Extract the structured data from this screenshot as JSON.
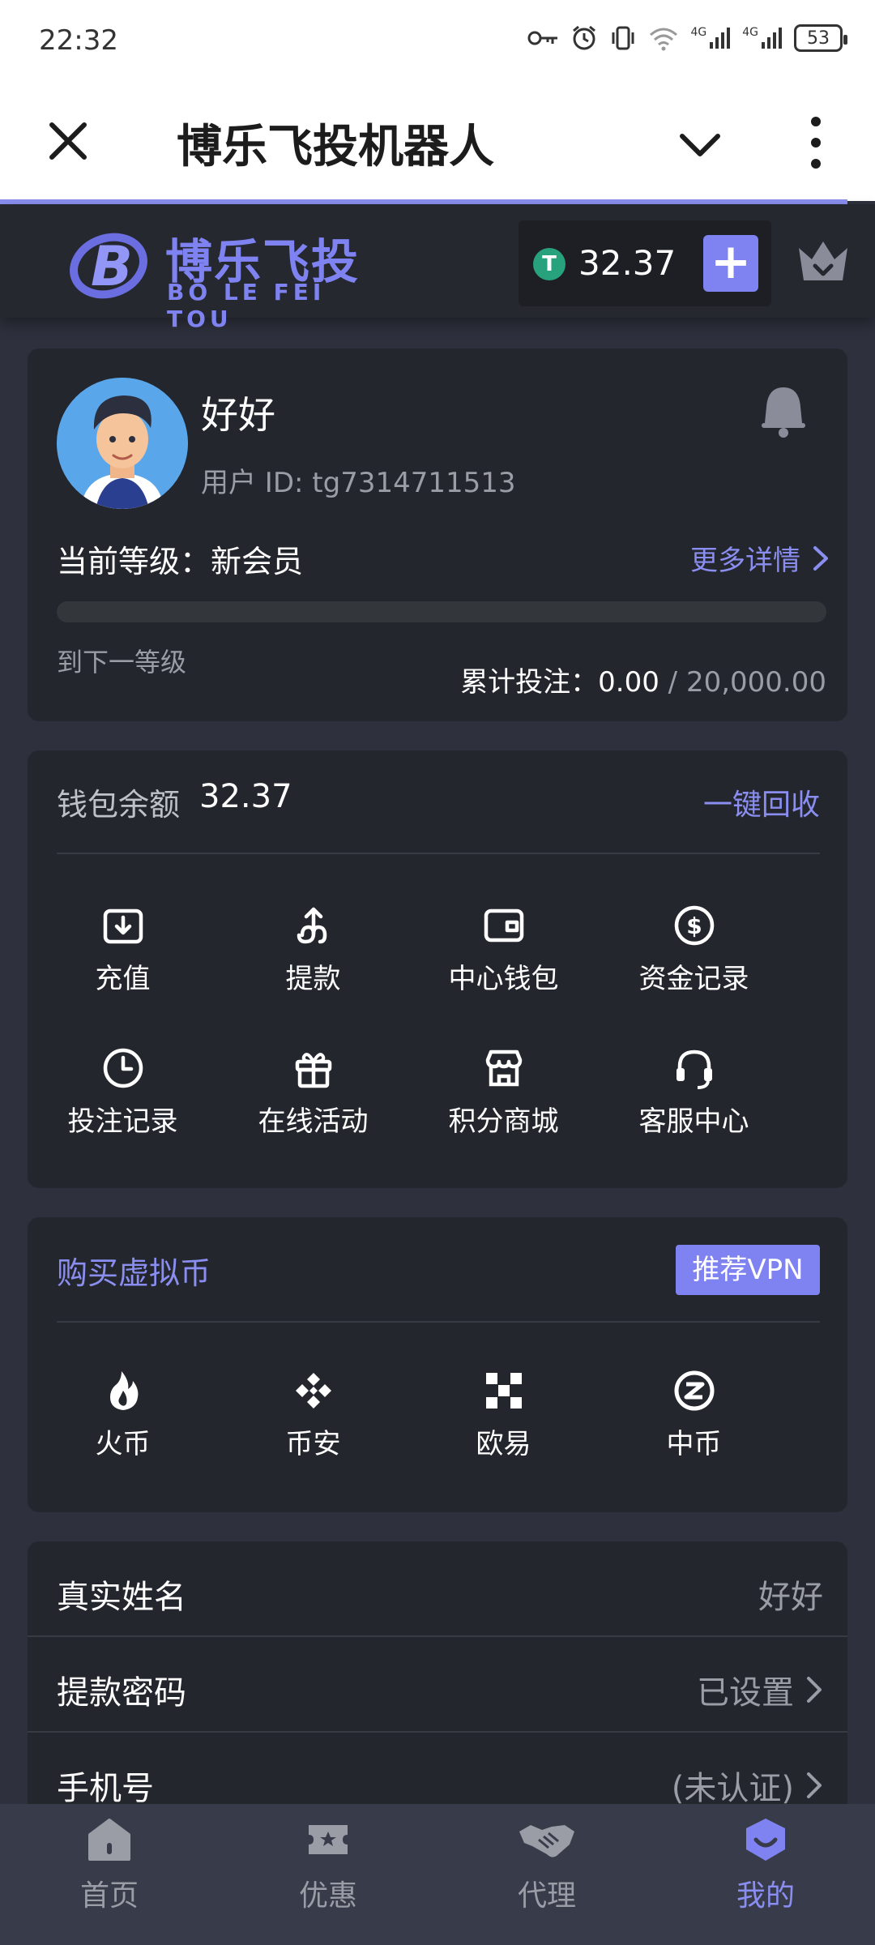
{
  "status_bar": {
    "time": "22:32",
    "network_1": "4G",
    "network_2": "4G",
    "battery": "53"
  },
  "title_bar": {
    "title": "博乐飞投机器人"
  },
  "header": {
    "logo_cn": "博乐飞投",
    "logo_en": "BO LE FEI TOU",
    "currency_symbol": "T",
    "balance": "32.37",
    "plus_label": "+"
  },
  "profile": {
    "username": "好好",
    "user_id": "用户 ID: tg7314711513",
    "level_label": "当前等级：新会员",
    "more_details": "更多详情",
    "level_progress_percent": 0,
    "next_level": "到下一等级",
    "bet_total_label": "累计投注：",
    "bet_total_value": "0.00",
    "bet_total_separator": " / ",
    "bet_total_target": "20,000.00"
  },
  "wallet": {
    "label": "钱包余额",
    "amount": "32.37",
    "recycle": "一键回收",
    "items": [
      {
        "label": "充值",
        "icon": "deposit-icon"
      },
      {
        "label": "提款",
        "icon": "withdraw-icon"
      },
      {
        "label": "中心钱包",
        "icon": "wallet-icon"
      },
      {
        "label": "资金记录",
        "icon": "dollar-icon"
      },
      {
        "label": "投注记录",
        "icon": "clock-icon"
      },
      {
        "label": "在线活动",
        "icon": "gift-icon"
      },
      {
        "label": "积分商城",
        "icon": "store-icon"
      },
      {
        "label": "客服中心",
        "icon": "headset-icon"
      }
    ]
  },
  "buy": {
    "title": "购买虚拟币",
    "vpn_button": "推荐VPN",
    "exchanges": [
      {
        "label": "火币",
        "icon": "huobi-icon"
      },
      {
        "label": "币安",
        "icon": "binance-icon"
      },
      {
        "label": "欧易",
        "icon": "okx-icon"
      },
      {
        "label": "中币",
        "icon": "zb-icon"
      }
    ]
  },
  "info": {
    "rows": [
      {
        "label": "真实姓名",
        "value": "好好"
      },
      {
        "label": "提款密码",
        "value": "已设置"
      },
      {
        "label": "手机号",
        "value": "(未认证)"
      }
    ]
  },
  "bottom_nav": {
    "items": [
      {
        "label": "首页",
        "icon": "home-icon"
      },
      {
        "label": "优惠",
        "icon": "ticket-icon"
      },
      {
        "label": "代理",
        "icon": "handshake-icon"
      },
      {
        "label": "我的",
        "icon": "profile-shield-icon"
      }
    ],
    "active": 3
  },
  "colors": {
    "accent": "#7f83f2",
    "background": "#2e313d",
    "card": "#24262e",
    "usdt": "#27a27c"
  }
}
